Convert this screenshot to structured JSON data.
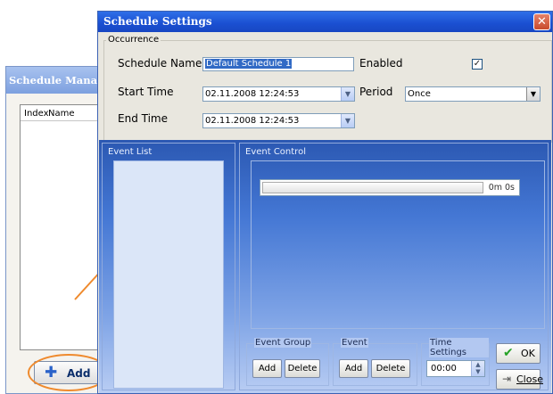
{
  "background_window": {
    "title": "Schedule Manager",
    "list_columns": [
      "Index",
      "Name"
    ],
    "add_label": "Add"
  },
  "dialog": {
    "title": "Schedule Settings",
    "close_glyph": "✕",
    "occurrence": {
      "group_label": "Occurrence",
      "schedule_name_label": "Schedule Name",
      "schedule_name_value": "Default Schedule 1",
      "enabled_label": "Enabled",
      "enabled_checked": true,
      "start_time_label": "Start Time",
      "start_time_value": "02.11.2008 12:24:53",
      "end_time_label": "End Time",
      "end_time_value": "02.11.2008 12:24:53",
      "period_label": "Period",
      "period_value": "Once"
    },
    "event_list": {
      "label": "Event List"
    },
    "event_control": {
      "label": "Event Control",
      "elapsed": "0m 0s"
    },
    "event_group": {
      "label": "Event Group",
      "add": "Add",
      "delete": "Delete"
    },
    "event": {
      "label": "Event",
      "add": "Add",
      "delete": "Delete"
    },
    "time_settings": {
      "label": "Time Settings",
      "value": "00:00"
    },
    "ok_label": "OK",
    "close_label": "Close"
  },
  "icons": {
    "add": "plus-icon",
    "ok": "check-icon",
    "close": "exit-icon",
    "dropdown": "chevron-down-icon"
  },
  "colors": {
    "title_bar": "#1a4fd1",
    "highlight": "#ef8a2d",
    "panel_blue": "#4477d4"
  }
}
